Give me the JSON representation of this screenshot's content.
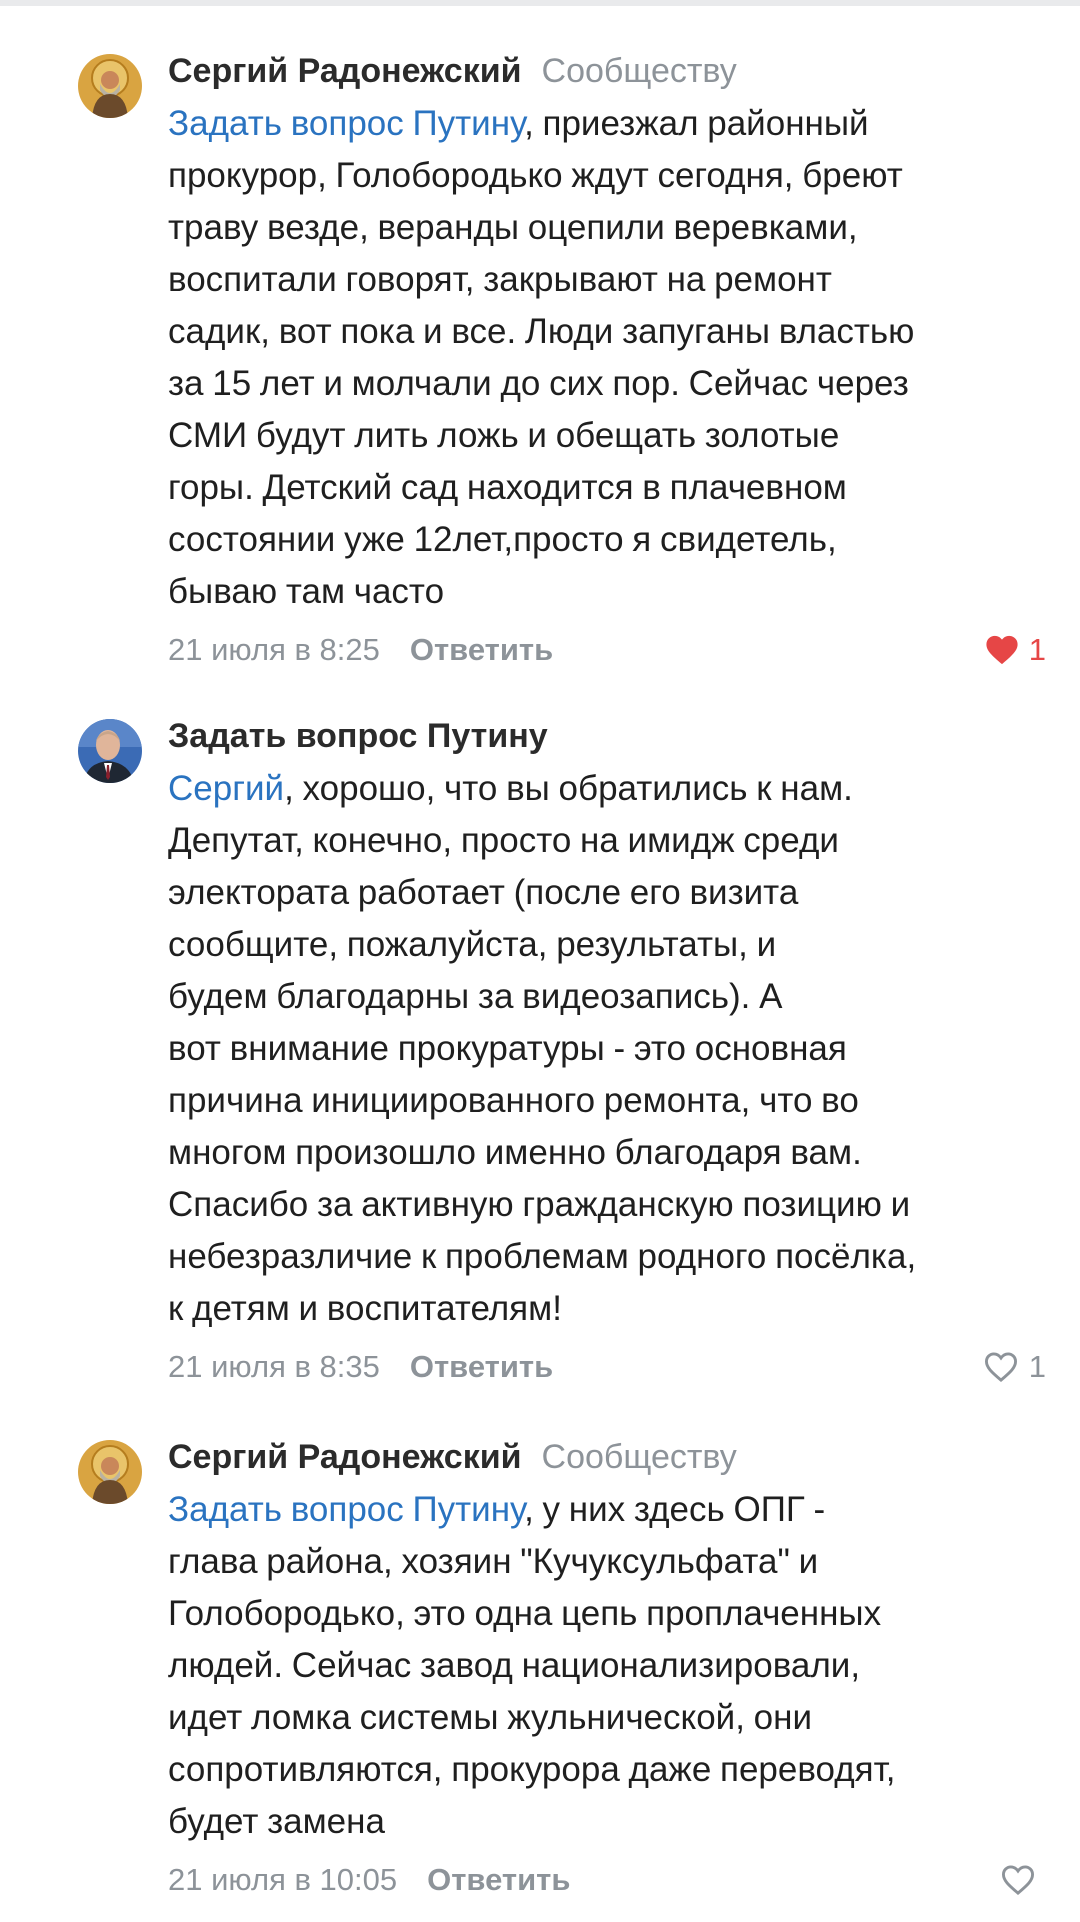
{
  "comments": [
    {
      "author": "Сергий Радонежский",
      "to": "Сообществу",
      "mention": "Задать вопрос Путину",
      "text": ", приезжал районный\nпрокурор, Голобородько ждут сегодня, бреют\nтраву везде, веранды оцепили веревками,\nвоспитали говорят, закрывают на ремонт\nсадик, вот пока и все. Люди запуганы властью\nза 15 лет и молчали до сих пор. Сейчас через\nСМИ будут лить ложь и обещать золотые\nгоры. Детский сад находится в плачевном\nсостоянии уже 12лет,просто я свидетель,\nбываю там часто",
      "time": "21 июля в 8:25",
      "reply": "Ответить",
      "likes": "1",
      "liked": true,
      "avatar": "saint-icon-avatar"
    },
    {
      "author": "Задать вопрос Путину",
      "to": "",
      "mention": "Сергий",
      "text": ", хорошо, что вы обратились к нам.\nДепутат, конечно, просто на имидж среди\nэлектората работает (после его визита\nсообщите, пожалуйста, результаты, и\nбудем благодарны за видеозапись). А\nвот внимание прокуратуры - это основная\nпричина инициированного ремонта, что во\nмногом произошло именно благодаря вам.\nСпасибо за активную гражданскую позицию и\nнебезразличие к проблемам родного посёлка,\nк детям и воспитателям!",
      "time": "21 июля в 8:35",
      "reply": "Ответить",
      "likes": "1",
      "liked": false,
      "avatar": "person-photo-avatar"
    },
    {
      "author": "Сергий Радонежский",
      "to": "Сообществу",
      "mention": "Задать вопрос Путину",
      "text": ", у них здесь ОПГ -\nглава района, хозяин \"Кучуксульфата\" и\nГолобородько, это одна цепь проплаченных\nлюдей. Сейчас завод национализировали,\nидет ломка системы жульнической, они\nсопротивляются, прокурора даже переводят,\nбудет замена",
      "time": "21 июля в 10:05",
      "reply": "Ответить",
      "likes": "",
      "liked": false,
      "avatar": "saint-icon-avatar"
    }
  ],
  "colors": {
    "link": "#2a73c0",
    "meta": "#8d9399",
    "like_active": "#e64646"
  }
}
